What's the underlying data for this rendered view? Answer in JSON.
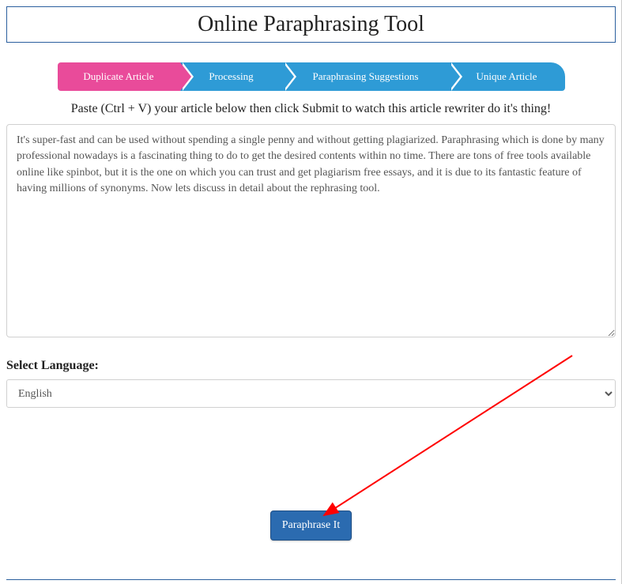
{
  "header": {
    "title": "Online Paraphrasing Tool"
  },
  "steps": {
    "s1": "Duplicate Article",
    "s2": "Processing",
    "s3": "Paraphrasing Suggestions",
    "s4": "Unique Article"
  },
  "instruction": "Paste (Ctrl + V) your article below then click Submit to watch this article rewriter do it's thing!",
  "textarea_value": "It's super-fast and can be used without spending a single penny and without getting plagiarized. Paraphrasing which is done by many professional nowadays is a fascinating thing to do to get the desired contents within no time. There are tons of free tools available online like spinbot, but it is the one on which you can trust and get plagiarism free essays, and it is due to its fantastic feature of having millions of synonyms. Now lets discuss in detail about the rephrasing tool.",
  "language": {
    "label": "Select Language:",
    "selected": "English"
  },
  "button": {
    "paraphrase": "Paraphrase It"
  },
  "arrow": {
    "color": "#ff0000"
  }
}
